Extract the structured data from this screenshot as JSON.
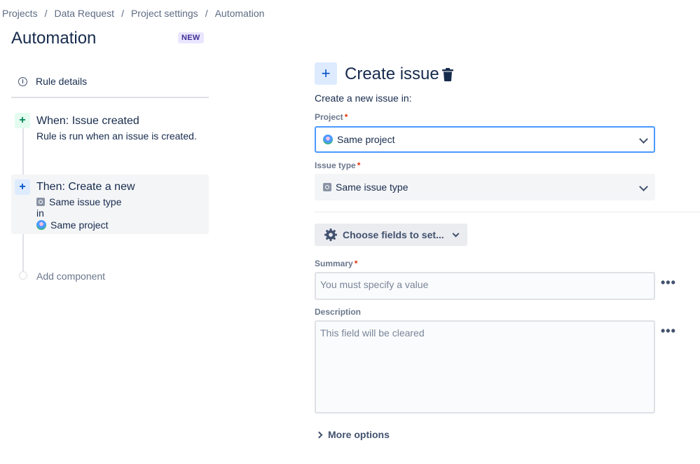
{
  "breadcrumb": [
    "Projects",
    "Data Request",
    "Project settings",
    "Automation"
  ],
  "page": {
    "title": "Automation",
    "badge": "NEW"
  },
  "rule": {
    "details_label": "Rule details",
    "trigger": {
      "title": "When: Issue created",
      "description": "Rule is run when an issue is created."
    },
    "action": {
      "title": "Then: Create a new",
      "issue_type": "Same issue type",
      "connector": "in",
      "project": "Same project"
    },
    "add_component": "Add component"
  },
  "form": {
    "title": "Create issue",
    "subtitle": "Create a new issue in:",
    "project": {
      "label": "Project",
      "value": "Same project"
    },
    "issue_type": {
      "label": "Issue type",
      "value": "Same issue type"
    },
    "choose_fields": "Choose fields to set...",
    "summary": {
      "label": "Summary",
      "placeholder": "You must specify a value"
    },
    "description": {
      "label": "Description",
      "placeholder": "This field will be cleared"
    },
    "more_options": "More options",
    "required_mark": "*"
  },
  "icons": {
    "info": "info-icon",
    "plus": "plus-icon",
    "trash": "trash-icon",
    "gear": "gear-icon",
    "chevron": "chevron-down-icon",
    "more": "more-icon",
    "expand": "chevron-right-icon"
  },
  "colors": {
    "focus": "#4c9aff",
    "brand": "#0052cc",
    "success": "#00875a",
    "required": "#de350b",
    "badge_bg": "#eae6ff"
  }
}
